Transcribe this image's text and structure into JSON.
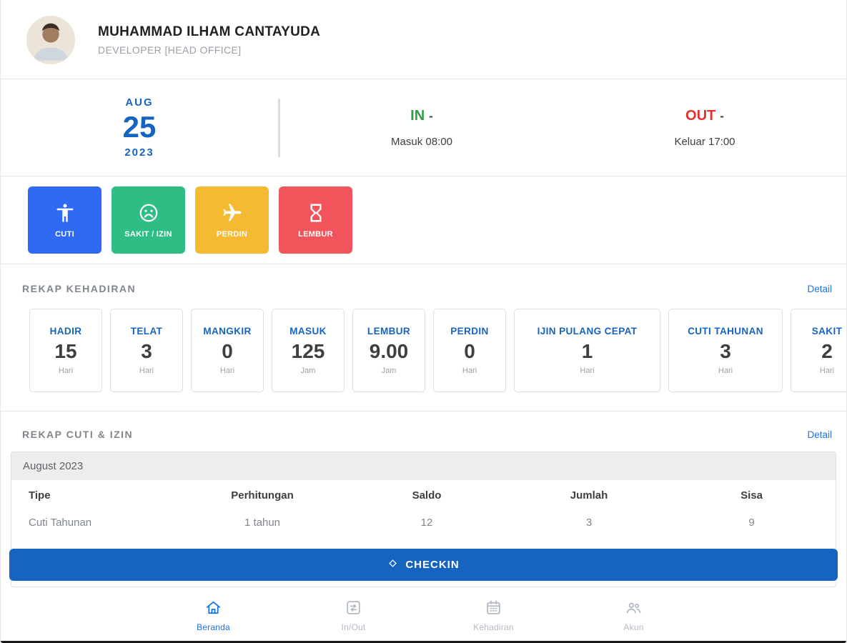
{
  "colors": {
    "primary_blue": "#1565c0",
    "link_blue": "#1a73e8",
    "cuti_button_blue": "#2e6af3",
    "sakit_button_green": "#2dbd85",
    "perdin_button_yellow": "#f6b932",
    "lembur_button_red": "#f2545b",
    "in_green": "#2f9e44",
    "out_red": "#e53030"
  },
  "header": {
    "name": "MUHAMMAD ILHAM CANTAYUDA",
    "role": "DEVELOPER [HEAD OFFICE]"
  },
  "date_panel": {
    "month": "AUG",
    "day": "25",
    "year": "2023"
  },
  "attendance_panel": {
    "in_label": "IN",
    "in_suffix": "-",
    "in_detail": "Masuk 08:00",
    "out_label": "OUT",
    "out_suffix": "-",
    "out_detail": "Keluar 17:00"
  },
  "actions": [
    {
      "label": "CUTI",
      "icon": "person-icon",
      "color": "#2e6af3"
    },
    {
      "label": "SAKIT / IZIN",
      "icon": "sad-face-icon",
      "color": "#2dbd85"
    },
    {
      "label": "PERDIN",
      "icon": "airplane-icon",
      "color": "#f6b932"
    },
    {
      "label": "LEMBUR",
      "icon": "hourglass-icon",
      "color": "#f2545b"
    }
  ],
  "rekap_kehadiran": {
    "title": "REKAP KEHADIRAN",
    "detail_label": "Detail",
    "cards": [
      {
        "label": "HADIR",
        "value": "15",
        "unit": "Hari"
      },
      {
        "label": "TELAT",
        "value": "3",
        "unit": "Hari"
      },
      {
        "label": "MANGKIR",
        "value": "0",
        "unit": "Hari"
      },
      {
        "label": "MASUK",
        "value": "125",
        "unit": "Jam"
      },
      {
        "label": "LEMBUR",
        "value": "9.00",
        "unit": "Jam"
      },
      {
        "label": "PERDIN",
        "value": "0",
        "unit": "Hari"
      },
      {
        "label": "IJIN PULANG CEPAT",
        "value": "1",
        "unit": "Hari"
      },
      {
        "label": "CUTI TAHUNAN",
        "value": "3",
        "unit": "Hari"
      },
      {
        "label": "SAKIT",
        "value": "2",
        "unit": "Hari"
      }
    ]
  },
  "rekap_cuti_izin": {
    "title": "REKAP CUTI & IZIN",
    "detail_label": "Detail",
    "period": "August 2023",
    "columns": [
      "Tipe",
      "Perhitungan",
      "Saldo",
      "Jumlah",
      "Sisa"
    ],
    "rows": [
      {
        "tipe": "Cuti Tahunan",
        "perhitungan": "1 tahun",
        "saldo": "12",
        "jumlah": "3",
        "sisa": "9"
      }
    ]
  },
  "checkin_button": {
    "label": "CHECKIN"
  },
  "bottom_nav": {
    "items": [
      {
        "label": "Beranda",
        "icon": "home-icon",
        "active": true
      },
      {
        "label": "In/Out",
        "icon": "in-out-icon",
        "active": false
      },
      {
        "label": "Kehadiran",
        "icon": "calendar-icon",
        "active": false
      },
      {
        "label": "Akun",
        "icon": "account-icon",
        "active": false
      }
    ]
  }
}
